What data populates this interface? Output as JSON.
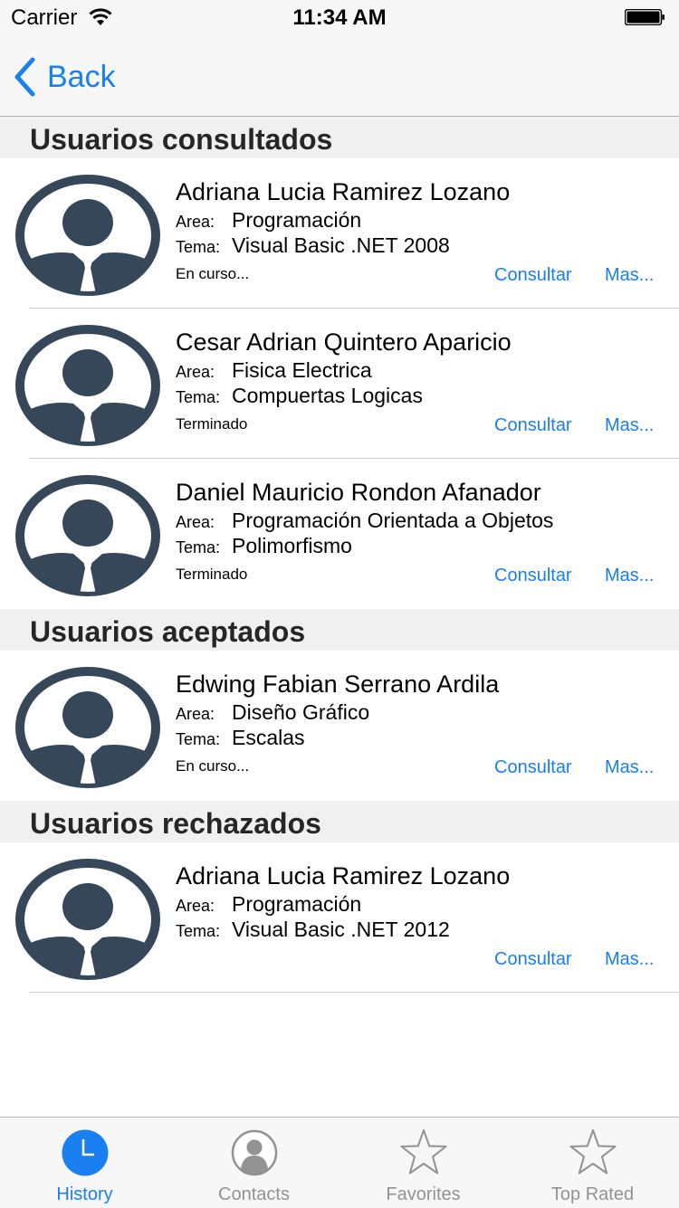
{
  "status_bar": {
    "carrier": "Carrier",
    "time": "11:34 AM"
  },
  "nav": {
    "back_label": "Back"
  },
  "labels": {
    "area": "Area:",
    "tema": "Tema:",
    "consultar": "Consultar",
    "mas": "Mas..."
  },
  "sections": [
    {
      "title": "Usuarios consultados",
      "rows": [
        {
          "name": "Adriana Lucia Ramirez Lozano",
          "area": "Programación",
          "tema": "Visual Basic .NET 2008",
          "status": "En curso..."
        },
        {
          "name": "Cesar Adrian Quintero Aparicio",
          "area": "Fisica Electrica",
          "tema": "Compuertas Logicas",
          "status": "Terminado"
        },
        {
          "name": "Daniel Mauricio Rondon Afanador",
          "area": "Programación Orientada a Objetos",
          "tema": "Polimorfismo",
          "status": "Terminado"
        }
      ]
    },
    {
      "title": "Usuarios aceptados",
      "rows": [
        {
          "name": "Edwing Fabian Serrano Ardila",
          "area": "Diseño Gráfico",
          "tema": "Escalas",
          "status": "En curso..."
        }
      ]
    },
    {
      "title": "Usuarios rechazados",
      "rows": [
        {
          "name": "Adriana Lucia Ramirez Lozano",
          "area": "Programación",
          "tema": "Visual Basic .NET 2012",
          "status": ""
        }
      ]
    }
  ],
  "tabs": [
    {
      "label": "History",
      "icon": "clock-icon",
      "active": true
    },
    {
      "label": "Contacts",
      "icon": "contacts-icon",
      "active": false
    },
    {
      "label": "Favorites",
      "icon": "star-icon",
      "active": false
    },
    {
      "label": "Top Rated",
      "icon": "star-icon",
      "active": false
    }
  ],
  "colors": {
    "accent": "#1a7ff0",
    "avatar": "#36475a",
    "section_bg": "#f0f0f0",
    "bar_bg": "#f7f7f7"
  }
}
